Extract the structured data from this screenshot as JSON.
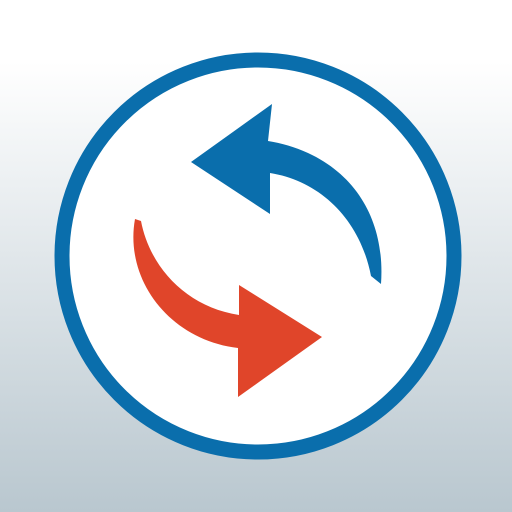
{
  "icon": {
    "name": "sync-arrows-icon",
    "colors": {
      "background_top": "#ffffff",
      "background_bottom": "#b9c7cf",
      "ring": "#0a6eac",
      "circle_fill": "#ffffff",
      "arrow_top": "#0a6eac",
      "arrow_bottom": "#e0452a"
    }
  }
}
